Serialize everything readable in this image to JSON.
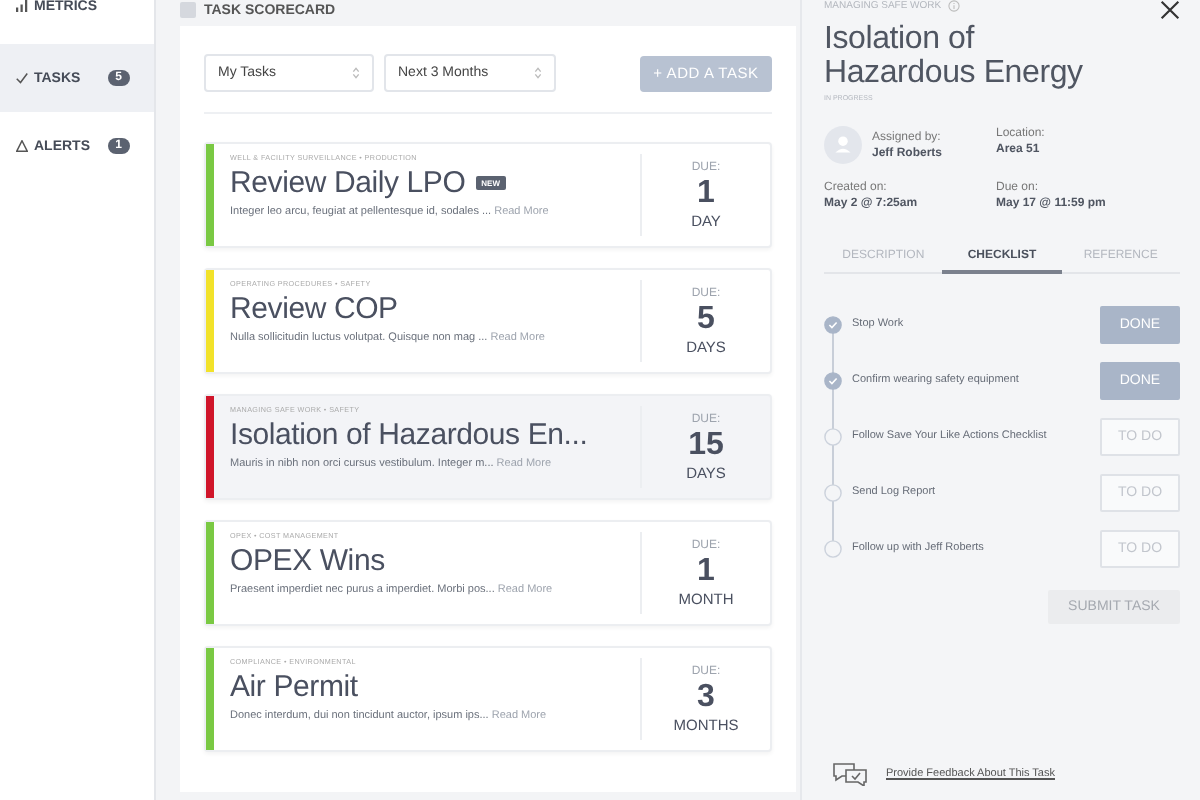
{
  "sidebar": {
    "items": [
      {
        "label": "METRICS",
        "selected": false
      },
      {
        "label": "TASKS",
        "count": "5",
        "selected": true
      },
      {
        "label": "ALERTS",
        "count": "1",
        "selected": false
      }
    ]
  },
  "scorecard": {
    "title": "TASK SCORECARD",
    "filters": [
      "My Tasks",
      "Next 3 Months"
    ],
    "add_button": "+ ADD A TASK",
    "tasks": [
      {
        "category": "WELL & FACILITY SURVEILLANCE • PRODUCTION",
        "title": "Review Daily LPO",
        "badge": "NEW",
        "excerpt": "Integer leo arcu, feugiat at pellentesque id, sodales ...",
        "read_more": "Read More",
        "due_label": "DUE:",
        "due_value": "1",
        "due_unit": "DAY",
        "color": "#7ac943",
        "selected": false
      },
      {
        "category": "OPERATING PROCEDURES • SAFETY",
        "title": "Review COP",
        "excerpt": "Nulla sollicitudin luctus volutpat. Quisque non mag ...",
        "read_more": "Read More",
        "due_label": "DUE:",
        "due_value": "5",
        "due_unit": "DAYS",
        "color": "#f2e22a",
        "selected": false
      },
      {
        "category": "MANAGING SAFE WORK • SAFETY",
        "title": "Isolation of Hazardous En...",
        "excerpt": "Mauris in nibh non orci cursus vestibulum. Integer m...",
        "read_more": "Read More",
        "due_label": "DUE:",
        "due_value": "15",
        "due_unit": "DAYS",
        "color": "#d0152a",
        "selected": true
      },
      {
        "category": "OPEX • COST MANAGEMENT",
        "title": "OPEX Wins",
        "excerpt": "Praesent imperdiet nec purus a imperdiet. Morbi pos...",
        "read_more": "Read More",
        "due_label": "DUE:",
        "due_value": "1",
        "due_unit": "MONTH",
        "color": "#7ac943",
        "selected": false
      },
      {
        "category": "COMPLIANCE • ENVIRONMENTAL",
        "title": "Air Permit",
        "excerpt": "Donec interdum, dui non tincidunt auctor, ipsum ips...",
        "read_more": "Read More",
        "due_label": "DUE:",
        "due_value": "3",
        "due_unit": "MONTHS",
        "color": "#7ac943",
        "selected": false
      }
    ]
  },
  "detail": {
    "category": "MANAGING SAFE WORK",
    "title": "Isolation of Hazardous Energy",
    "status": "IN PROGRESS",
    "assigned_label": "Assigned by:",
    "assigned_value": "Jeff Roberts",
    "location_label": "Location:",
    "location_value": "Area 51",
    "created_label": "Created on:",
    "created_value": "May 2 @ 7:25am",
    "due_label": "Due on:",
    "due_value": "May 17 @ 11:59 pm",
    "tabs": [
      {
        "label": "DESCRIPTION",
        "selected": false
      },
      {
        "label": "CHECKLIST",
        "selected": true
      },
      {
        "label": "REFERENCE",
        "selected": false
      }
    ],
    "checklist": [
      {
        "label": "Stop Work",
        "checked": true,
        "button": "DONE"
      },
      {
        "label": "Confirm wearing safety equipment",
        "checked": true,
        "button": "DONE"
      },
      {
        "label": "Follow Save Your Like Actions Checklist",
        "checked": false,
        "button": "TO DO"
      },
      {
        "label": "Send Log Report",
        "checked": false,
        "button": "TO DO"
      },
      {
        "label": "Follow up with Jeff Roberts",
        "checked": false,
        "button": "TO DO"
      }
    ],
    "submit_button": "SUBMIT TASK",
    "feedback_link": "Provide Feedback About This Task"
  }
}
